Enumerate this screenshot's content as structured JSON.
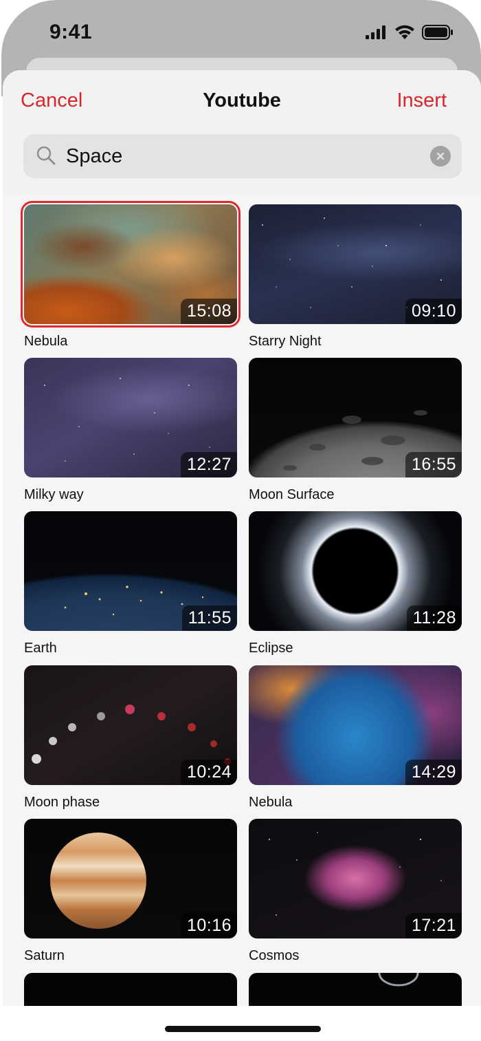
{
  "status": {
    "time": "9:41"
  },
  "sheet": {
    "cancel_label": "Cancel",
    "title": "Youtube",
    "insert_label": "Insert",
    "accent_color": "#d8262b"
  },
  "search": {
    "value": "Space",
    "icon": "search-icon",
    "clear_icon": "clear-icon"
  },
  "videos": [
    {
      "title": "Nebula",
      "duration": "15:08",
      "selected": true
    },
    {
      "title": "Starry Night",
      "duration": "09:10",
      "selected": false
    },
    {
      "title": "Milky way",
      "duration": "12:27",
      "selected": false
    },
    {
      "title": "Moon Surface",
      "duration": "16:55",
      "selected": false
    },
    {
      "title": "Earth",
      "duration": "11:55",
      "selected": false
    },
    {
      "title": "Eclipse",
      "duration": "11:28",
      "selected": false
    },
    {
      "title": "Moon phase",
      "duration": "10:24",
      "selected": false
    },
    {
      "title": "Nebula",
      "duration": "14:29",
      "selected": false
    },
    {
      "title": "Saturn",
      "duration": "10:16",
      "selected": false
    },
    {
      "title": "Cosmos",
      "duration": "17:21",
      "selected": false
    }
  ]
}
